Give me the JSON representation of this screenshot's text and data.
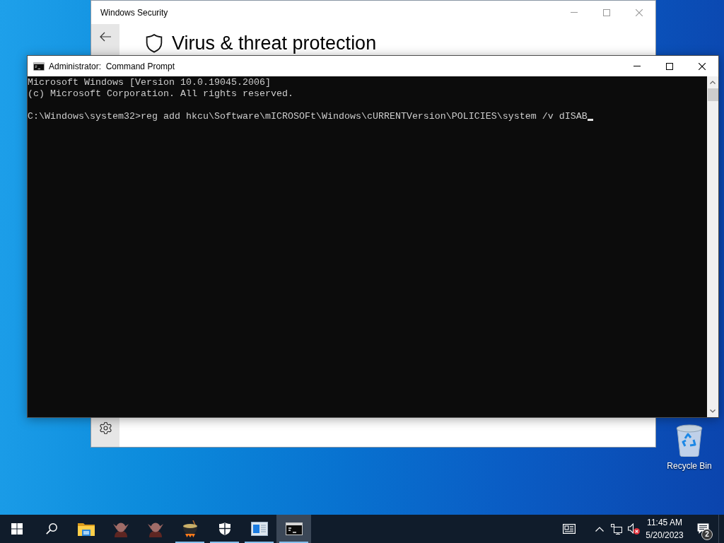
{
  "security_window": {
    "title": "Windows Security",
    "heading": "Virus & threat protection"
  },
  "command_prompt": {
    "title": "Administrator:  Command Prompt",
    "output": [
      "Microsoft Windows [Version 10.0.19045.2006]",
      "(c) Microsoft Corporation. All rights reserved."
    ],
    "input_line": "C:\\Windows\\system32>reg add hkcu\\Software\\mICROSOFt\\Windows\\cURRENTVersion\\POLICIES\\system /v dISAB"
  },
  "desktop_icons": [
    {
      "label": "Recycle Bin"
    }
  ],
  "taskbar": {
    "apps": [
      {
        "kind": "folder",
        "running": false,
        "selected": false
      },
      {
        "kind": "creature",
        "running": false,
        "selected": false
      },
      {
        "kind": "creature",
        "running": false,
        "selected": false
      },
      {
        "kind": "cauldron",
        "running": true,
        "selected": false
      },
      {
        "kind": "shield",
        "running": true,
        "selected": false
      },
      {
        "kind": "window",
        "running": true,
        "selected": false
      },
      {
        "kind": "console",
        "running": true,
        "selected": true
      }
    ],
    "volume": {
      "muted": true
    },
    "clock": {
      "time": "11:45 AM",
      "date": "5/20/2023"
    },
    "notification_count": "2"
  }
}
